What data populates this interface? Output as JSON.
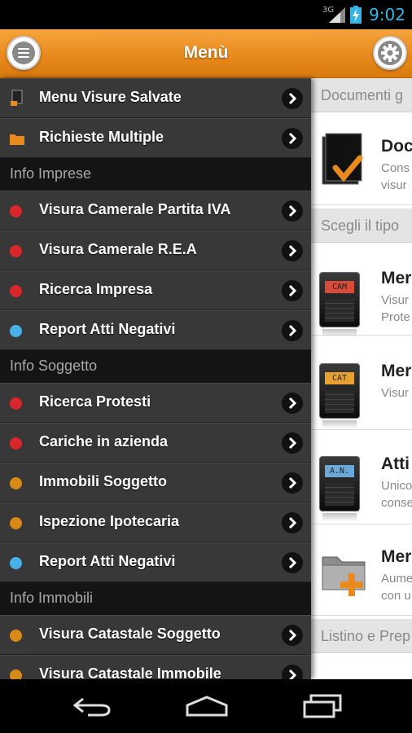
{
  "status_bar": {
    "network": "3G",
    "time": "9:02",
    "icons": [
      "signal-icon",
      "battery-charging-icon"
    ]
  },
  "action_bar": {
    "title": "Menù",
    "left_icon": "menu-icon",
    "right_icon": "gear-icon"
  },
  "drawer": {
    "items": [
      {
        "label": "Menu Visure Salvate",
        "icon": "saved-icon"
      },
      {
        "label": "Richieste Multiple",
        "icon": "folder-icon"
      },
      {
        "section": "Info Imprese"
      },
      {
        "label": "Visura Camerale Partita IVA",
        "dot": "red"
      },
      {
        "label": "Visura Camerale R.E.A",
        "dot": "red"
      },
      {
        "label": "Ricerca Impresa",
        "dot": "red"
      },
      {
        "label": "Report Atti Negativi",
        "dot": "blue"
      },
      {
        "section": "Info Soggetto"
      },
      {
        "label": "Ricerca Protesti",
        "dot": "red"
      },
      {
        "label": "Cariche in azienda",
        "dot": "red"
      },
      {
        "label": "Immobili Soggetto",
        "dot": "orange"
      },
      {
        "label": "Ispezione Ipotecaria",
        "dot": "orange"
      },
      {
        "label": "Report Atti Negativi",
        "dot": "blue"
      },
      {
        "section": "Info Immobili"
      },
      {
        "label": "Visura Catastale Soggetto",
        "dot": "orange"
      },
      {
        "label": "Visura Catastale Immobile",
        "dot": "orange"
      }
    ]
  },
  "content": {
    "sections": [
      "Documenti g",
      "Scegli il tipo",
      "Listino e Prep"
    ],
    "cards": [
      {
        "title": "Doc",
        "desc": [
          "Cons",
          "visur"
        ],
        "icon": "document-check-icon"
      },
      {
        "title": "Mer",
        "desc": [
          "Visur",
          "Prote"
        ],
        "icon": "phone-cam-icon",
        "badge": "CAM",
        "badge_color": "#d84a3a"
      },
      {
        "title": "Mer",
        "desc": [
          "Visur"
        ],
        "icon": "phone-cat-icon",
        "badge": "CAT",
        "badge_color": "#e8a030"
      },
      {
        "title": "Atti",
        "desc": [
          "Unico",
          "conse"
        ],
        "icon": "phone-an-icon",
        "badge": "A.N.",
        "badge_color": "#6aa8d8"
      },
      {
        "title": "Mer",
        "desc": [
          "Aume",
          "con u"
        ],
        "icon": "folder-add-icon"
      }
    ]
  },
  "colors": {
    "red": "#d8262a",
    "blue": "#4ab0e8",
    "orange": "#d88a18",
    "accent": "#ee8f20",
    "clock": "#33b5e5"
  },
  "nav_bar": {
    "icons": [
      "back-icon",
      "home-icon",
      "recent-apps-icon"
    ]
  }
}
